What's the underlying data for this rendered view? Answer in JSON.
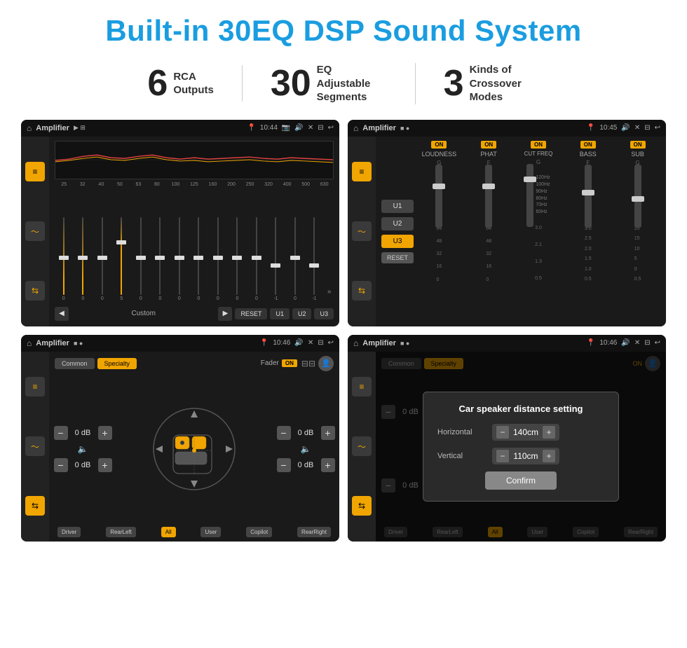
{
  "page": {
    "title": "Built-in 30EQ DSP Sound System",
    "stats": [
      {
        "number": "6",
        "label": "RCA\nOutputs"
      },
      {
        "number": "30",
        "label": "EQ Adjustable\nSegments"
      },
      {
        "number": "3",
        "label": "Kinds of\nCrossover Modes"
      }
    ]
  },
  "screen1": {
    "app_name": "Amplifier",
    "time": "10:44",
    "eq_bands": [
      "25",
      "32",
      "40",
      "50",
      "63",
      "80",
      "100",
      "125",
      "160",
      "200",
      "250",
      "320",
      "400",
      "500",
      "630"
    ],
    "eq_values": [
      "0",
      "0",
      "0",
      "5",
      "0",
      "0",
      "0",
      "0",
      "0",
      "0",
      "0",
      "-1",
      "0",
      "-1",
      "0"
    ],
    "footer_label": "Custom",
    "reset_label": "RESET",
    "u1_label": "U1",
    "u2_label": "U2",
    "u3_label": "U3"
  },
  "screen2": {
    "app_name": "Amplifier",
    "time": "10:45",
    "u_buttons": [
      "U1",
      "U2",
      "U3"
    ],
    "active_u": "U3",
    "channels": [
      {
        "name": "LOUDNESS",
        "toggle": "ON",
        "sub": "G"
      },
      {
        "name": "PHAT",
        "toggle": "ON",
        "sub": "F"
      },
      {
        "name": "CUT FREQ",
        "toggle": "ON",
        "sub": "G"
      },
      {
        "name": "BASS",
        "toggle": "ON",
        "sub": "F"
      },
      {
        "name": "SUB",
        "toggle": "ON",
        "sub": "G"
      }
    ],
    "reset_label": "RESET"
  },
  "screen3": {
    "app_name": "Amplifier",
    "time": "10:46",
    "tab1": "Common",
    "tab2": "Specialty",
    "fader_label": "Fader",
    "fader_on": "ON",
    "db_values": [
      "0 dB",
      "0 dB",
      "0 dB",
      "0 dB"
    ],
    "positions": [
      "Driver",
      "RearLeft",
      "All",
      "User",
      "Copilot",
      "RearRight"
    ]
  },
  "screen4": {
    "app_name": "Amplifier",
    "time": "10:46",
    "tab1": "Common",
    "tab2": "Specialty",
    "dialog": {
      "title": "Car speaker distance setting",
      "horizontal_label": "Horizontal",
      "horizontal_value": "140cm",
      "vertical_label": "Vertical",
      "vertical_value": "110cm",
      "confirm_label": "Confirm"
    },
    "positions": [
      "Driver",
      "RearLeft",
      "All",
      "User",
      "Copilot",
      "RearRight"
    ]
  }
}
